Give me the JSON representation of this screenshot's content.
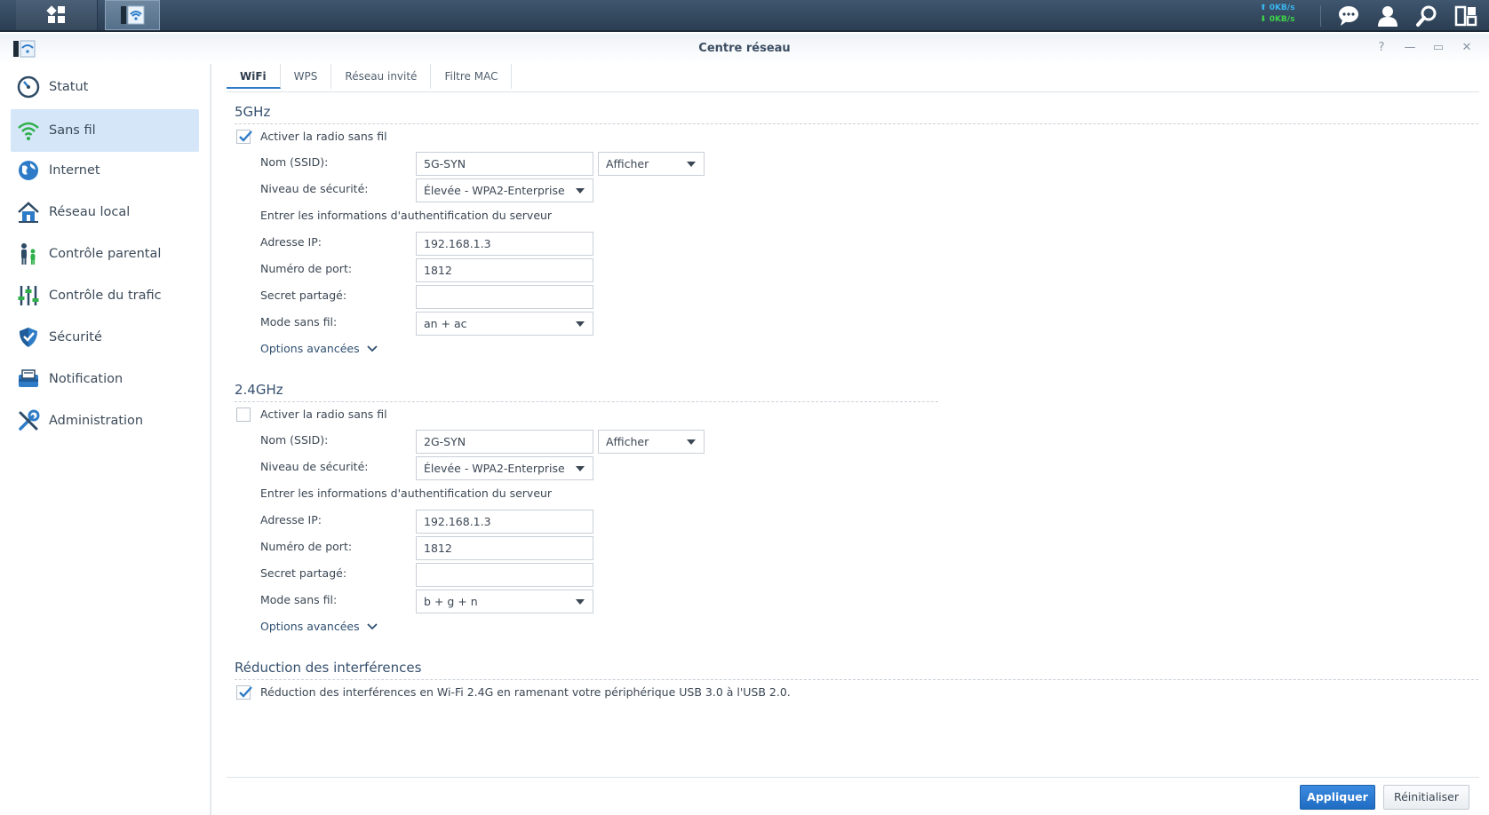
{
  "taskbar": {
    "upload_speed": "0KB/s",
    "download_speed": "0KB/s"
  },
  "window": {
    "title": "Centre réseau",
    "controls": [
      "?",
      "—",
      "▭",
      "✕"
    ]
  },
  "sidebar": {
    "items": [
      {
        "label": "Statut",
        "icon": "gauge-icon"
      },
      {
        "label": "Sans fil",
        "icon": "wifi-icon",
        "active": true
      },
      {
        "label": "Internet",
        "icon": "globe-icon"
      },
      {
        "label": "Réseau local",
        "icon": "home-network-icon"
      },
      {
        "label": "Contrôle parental",
        "icon": "family-icon"
      },
      {
        "label": "Contrôle du trafic",
        "icon": "sliders-icon"
      },
      {
        "label": "Sécurité",
        "icon": "shield-icon"
      },
      {
        "label": "Notification",
        "icon": "mailbox-icon"
      },
      {
        "label": "Administration",
        "icon": "tools-icon"
      }
    ]
  },
  "tabs": [
    {
      "label": "WiFi",
      "active": true
    },
    {
      "label": "WPS"
    },
    {
      "label": "Réseau invité"
    },
    {
      "label": "Filtre MAC"
    }
  ],
  "band5": {
    "title": "5GHz",
    "enable_label": "Activer la radio sans fil",
    "enabled": true,
    "ssid_label": "Nom (SSID):",
    "ssid_value": "5G-SYN",
    "show_option": "Afficher",
    "security_label": "Niveau de sécurité:",
    "security_value": "Élevée - WPA2-Enterprise",
    "auth_info": "Entrer les informations d'authentification du serveur",
    "ip_label": "Adresse IP:",
    "ip_value": "192.168.1.3",
    "port_label": "Numéro de port:",
    "port_value": "1812",
    "secret_label": "Secret partagé:",
    "secret_value": "",
    "mode_label": "Mode sans fil:",
    "mode_value": "an + ac",
    "advanced_label": "Options avancées"
  },
  "band24": {
    "title": "2.4GHz",
    "enable_label": "Activer la radio sans fil",
    "enabled": false,
    "ssid_label": "Nom (SSID):",
    "ssid_value": "2G-SYN",
    "show_option": "Afficher",
    "security_label": "Niveau de sécurité:",
    "security_value": "Élevée - WPA2-Enterprise",
    "auth_info": "Entrer les informations d'authentification du serveur",
    "ip_label": "Adresse IP:",
    "ip_value": "192.168.1.3",
    "port_label": "Numéro de port:",
    "port_value": "1812",
    "secret_label": "Secret partagé:",
    "secret_value": "",
    "mode_label": "Mode sans fil:",
    "mode_value": "b + g + n",
    "advanced_label": "Options avancées"
  },
  "interference": {
    "title": "Réduction des interférences",
    "checkbox_label": "Réduction des interférences en Wi-Fi 2.4G en ramenant votre périphérique USB 3.0 à l'USB 2.0.",
    "enabled": true
  },
  "footer": {
    "apply_label": "Appliquer",
    "reset_label": "Réinitialiser"
  },
  "colors": {
    "accent": "#2e7cc8",
    "sidebar_active": "#d4e6f8",
    "apply_button": "#2b79d2"
  }
}
